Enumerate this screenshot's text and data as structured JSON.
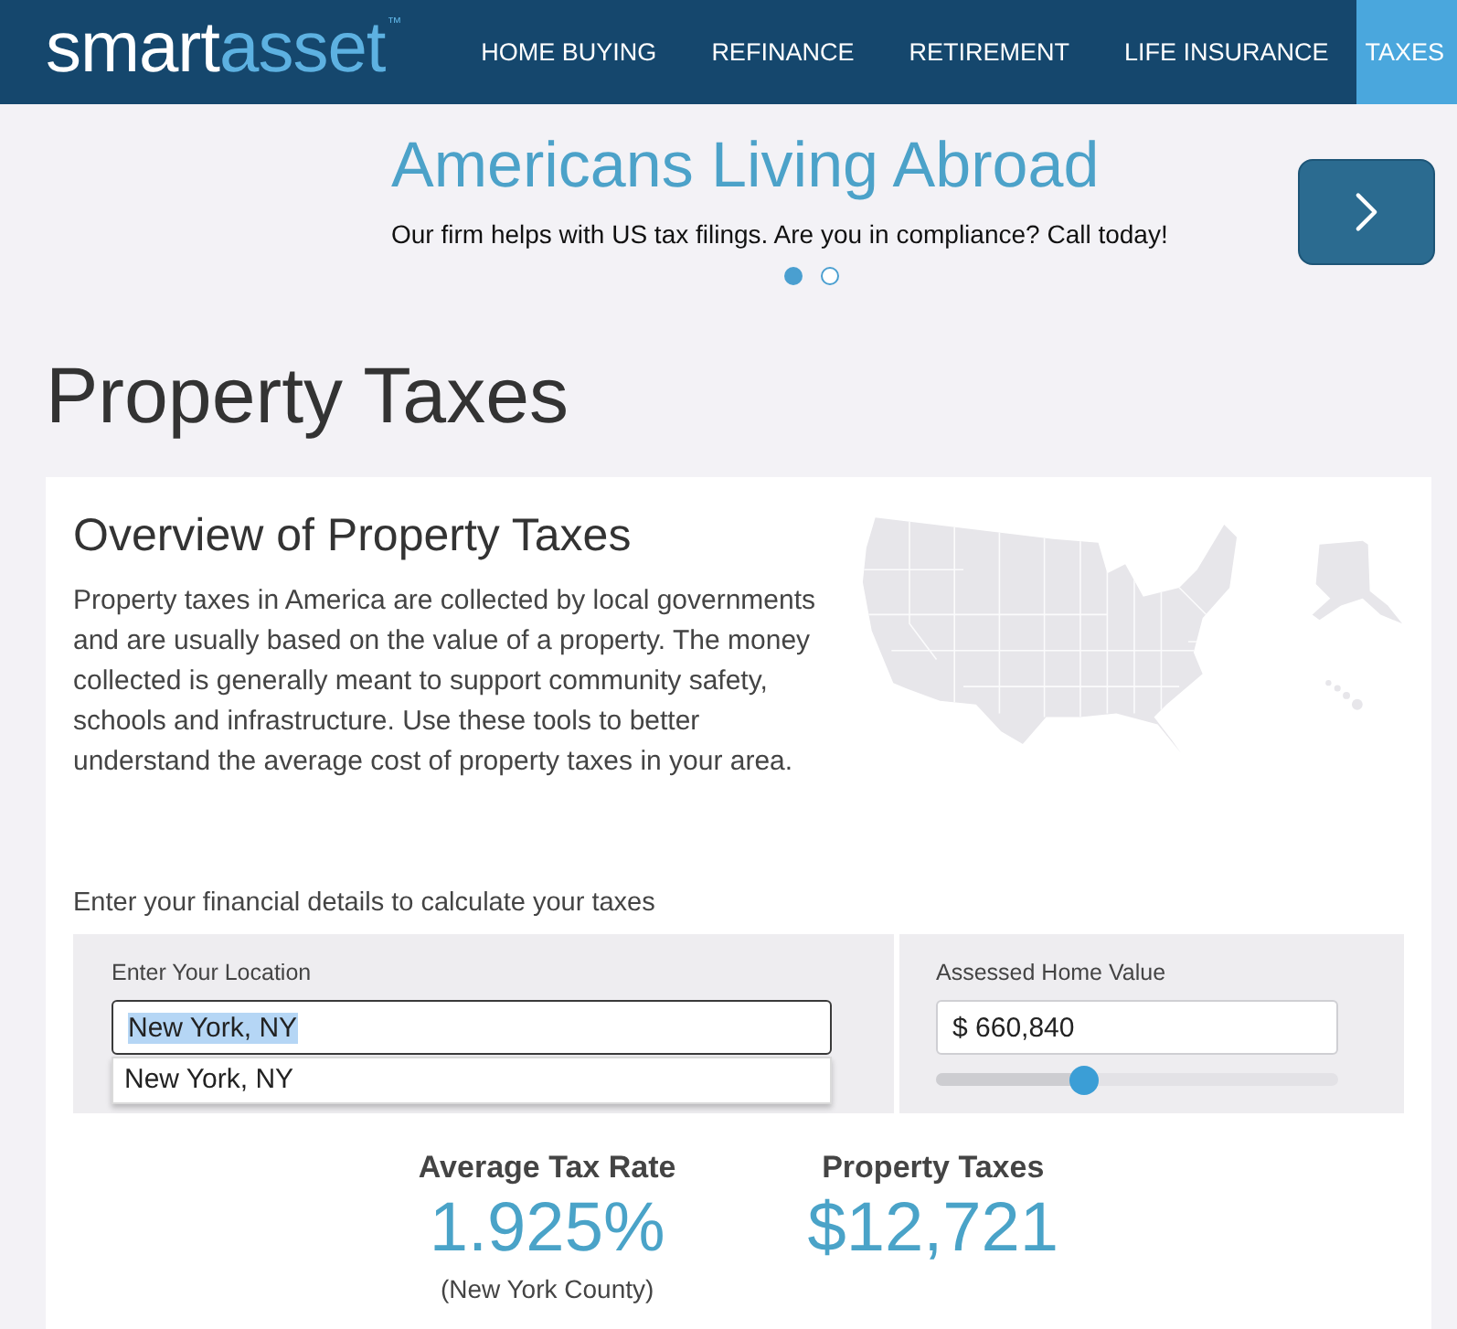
{
  "header": {
    "logo": {
      "primary": "smart",
      "accent": "asset",
      "trademark": "™"
    },
    "nav": [
      {
        "label": "HOME BUYING",
        "selected": false
      },
      {
        "label": "REFINANCE",
        "selected": false
      },
      {
        "label": "RETIREMENT",
        "selected": false
      },
      {
        "label": "LIFE INSURANCE",
        "selected": false
      },
      {
        "label": "TAXES",
        "selected": true
      }
    ]
  },
  "banner": {
    "title": "Americans Living Abroad",
    "subtitle": "Our firm helps with US tax filings. Are you in compliance? Call today!",
    "dots": [
      {
        "selected": true
      },
      {
        "selected": false
      }
    ]
  },
  "page_title": "Property Taxes",
  "overview": {
    "title": "Overview of Property Taxes",
    "text": "Property taxes in America are collected by local governments and are usually based on the value of a property. The money collected is generally meant to support community safety, schools and infrastructure. Use these tools to better understand the average cost of property taxes in your area."
  },
  "calculator": {
    "prompt": "Enter your financial details to calculate your taxes",
    "location": {
      "label": "Enter Your Location",
      "value": "New York, NY",
      "focused": true,
      "text_selected": true,
      "suggestions": [
        "New York, NY"
      ]
    },
    "home_value": {
      "label": "Assessed Home Value",
      "value": "$ 660,840",
      "slider": {
        "level": 0.37
      }
    }
  },
  "results": [
    {
      "label": "Average Tax Rate",
      "value": "1.925%",
      "note": "(New York County)"
    },
    {
      "label": "Property Taxes",
      "value": "$12,721"
    }
  ]
}
